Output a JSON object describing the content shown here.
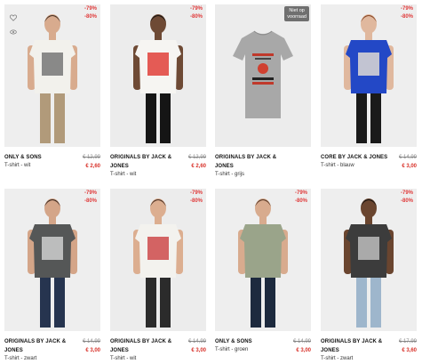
{
  "products": [
    {
      "brand": "ONLY & SONS",
      "desc": "T-shirt - wit",
      "old": "€ 12,99",
      "new": "€ 2,60",
      "b1": "-79%",
      "b2": "-80%",
      "bg": "#eeeeee",
      "shirt": "#f2f1ec",
      "print": "#777777",
      "pants": "#b19a7a",
      "skin": "#d8ab8e",
      "hair": "#4a3426"
    },
    {
      "brand": "ORIGINALS BY JACK & JONES",
      "desc": "T-shirt - wit",
      "old": "€ 12,99",
      "new": "€ 2,60",
      "b1": "-79%",
      "b2": "-80%",
      "bg": "#ececec",
      "shirt": "#f6f5f2",
      "print": "#e0403a",
      "pants": "#151515",
      "skin": "#6e4a35",
      "hair": "#1a1511"
    },
    {
      "brand": "ORIGINALS BY JACK & JONES",
      "desc": "T-shirt - grijs",
      "old": "",
      "new": "",
      "b1": "Niet op",
      "b2": "voorraad",
      "bg": "#ececec",
      "shirt": "#a8a8a8",
      "print": "#c0392b",
      "pants": "none",
      "skin": "",
      "hair": ""
    },
    {
      "brand": "CORE BY JACK & JONES",
      "desc": "T-shirt - blauw",
      "old": "€ 14,99",
      "new": "€ 3,00",
      "b1": "-79%",
      "b2": "-80%",
      "bg": "#eeeeee",
      "shirt": "#2348c6",
      "print": "#dedbd4",
      "pants": "#1a1a1a",
      "skin": "#e0b89e",
      "hair": "#8a4b2a"
    },
    {
      "brand": "ORIGINALS BY JACK & JONES",
      "desc": "T-shirt - zwart",
      "old": "€ 14,99",
      "new": "€ 3,00",
      "b1": "-79%",
      "b2": "-80%",
      "bg": "#eeeeee",
      "shirt": "#555757",
      "print": "#cfcfcf",
      "pants": "#26344f",
      "skin": "#d4a588",
      "hair": "#3d2b22"
    },
    {
      "brand": "ORIGINALS BY JACK & JONES",
      "desc": "T-shirt - wit",
      "old": "€ 14,99",
      "new": "€ 3,00",
      "b1": "-79%",
      "b2": "-80%",
      "bg": "#ececec",
      "shirt": "#f3f2ee",
      "print": "#cc4a4a",
      "pants": "#2b2b2b",
      "skin": "#dcae90",
      "hair": "#4d3325"
    },
    {
      "brand": "ONLY & SONS",
      "desc": "T-shirt - groen",
      "old": "€ 14,99",
      "new": "€ 3,00",
      "b1": "-79%",
      "b2": "-80%",
      "bg": "#eeeeee",
      "shirt": "#9aa48a",
      "print": "none",
      "pants": "#1d2a3e",
      "skin": "#d8ab8e",
      "hair": "#5a3b29"
    },
    {
      "brand": "ORIGINALS BY JACK & JONES",
      "desc": "T-shirt - zwart",
      "old": "€ 17,99",
      "new": "€ 3,60",
      "b1": "-79%",
      "b2": "-80%",
      "bg": "#eeeeee",
      "shirt": "#3c3c3c",
      "print": "#bdbdbd",
      "pants": "#9eb6cc",
      "skin": "#6a452f",
      "hair": "#1a1511"
    }
  ],
  "icons": {
    "wishlist": "heart-icon",
    "compare": "eye-icon"
  }
}
